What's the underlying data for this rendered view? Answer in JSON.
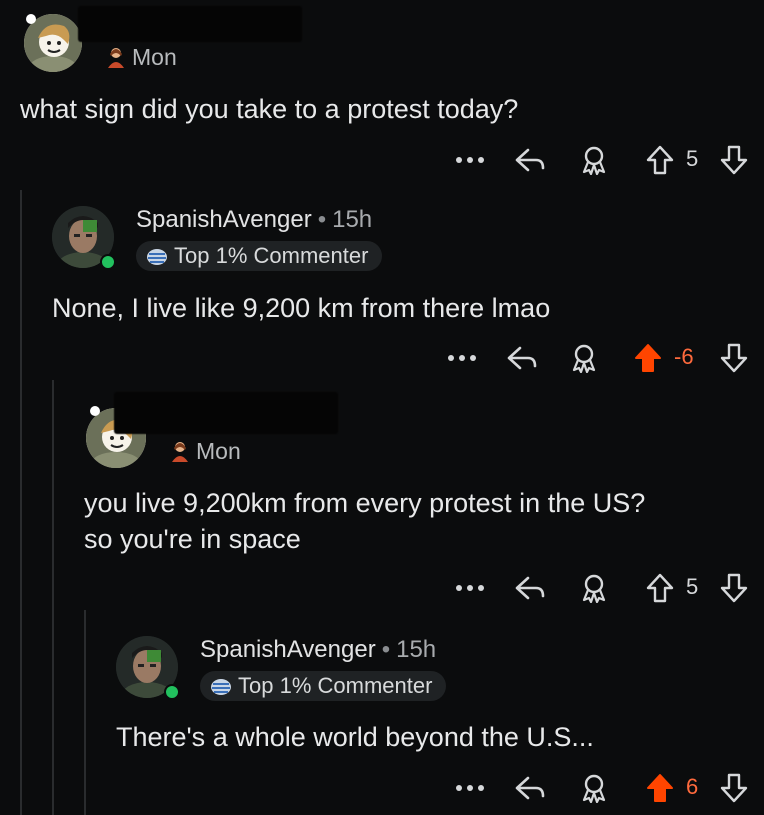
{
  "post": {
    "day": "Mon",
    "text": "what sign did you take to a protest today?",
    "score": "5"
  },
  "reply1": {
    "author": "SpanishAvenger",
    "separator": "•",
    "time": "15h",
    "badge": "Top 1% Commenter",
    "text": "None, I live like 9,200 km from there lmao",
    "score": "-6"
  },
  "reply2": {
    "day": "Mon",
    "line1": "you live 9,200km from every protest in the US?",
    "line2": "so you're in space",
    "score": "5"
  },
  "reply3": {
    "author": "SpanishAvenger",
    "separator": "•",
    "time": "15h",
    "badge": "Top 1% Commenter",
    "text": "There's a whole world beyond the U.S...",
    "score": "6"
  },
  "colors": {
    "background": "#0b0c0d",
    "upvote_active": "#ff4500",
    "online": "#22c15e"
  },
  "icons": [
    "more-icon",
    "reply-icon",
    "award-icon",
    "upvote-icon",
    "downvote-icon",
    "avatar-icon",
    "flair-icon",
    "badge-icon"
  ]
}
